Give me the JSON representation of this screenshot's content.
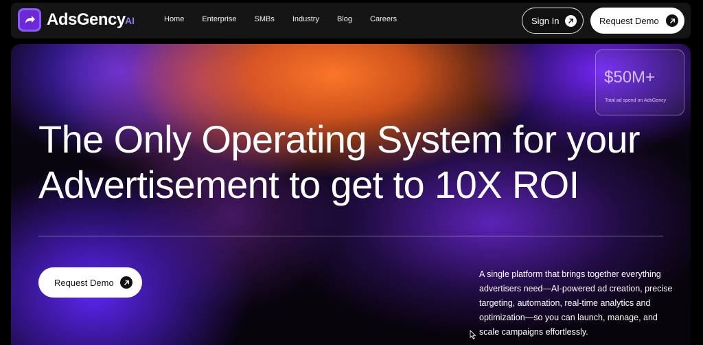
{
  "brand": {
    "name": "AdsGency",
    "suffix": "AI",
    "accent": "#8b5cf6"
  },
  "nav": {
    "links": [
      "Home",
      "Enterprise",
      "SMBs",
      "Industry",
      "Blog",
      "Careers"
    ],
    "sign_in": "Sign In",
    "request_demo": "Request Demo"
  },
  "stat": {
    "value": "$50M+",
    "label": "Total ad spend on AdsGency"
  },
  "hero": {
    "headline_line1": "The Only Operating System for your",
    "headline_line2": "Advertisement to get to 10X ROI",
    "cta": "Request Demo",
    "description": "A single platform that brings together everything advertisers need—AI-powered ad creation, precise targeting, automation, real-time analytics and optimization—so you can launch, manage, and scale campaigns effortlessly."
  },
  "icons": [
    "logo-arrow-icon",
    "arrow-up-right-icon",
    "mouse-cursor-icon"
  ]
}
